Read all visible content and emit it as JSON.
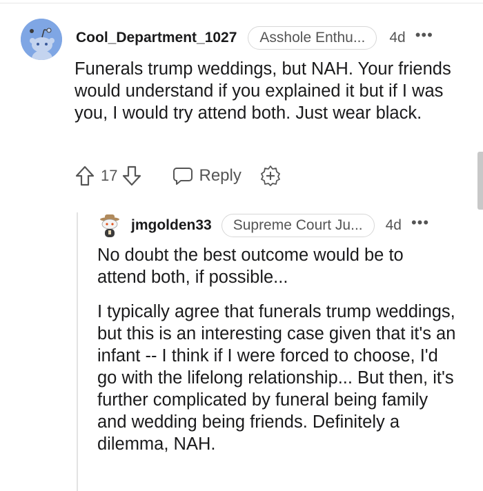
{
  "comment": {
    "username": "Cool_Department_1027",
    "flair": "Asshole Enthu...",
    "age": "4d",
    "more": "•••",
    "body": "Funerals trump weddings, but NAH. Your friends would understand if you explained it but if I was you, I would try attend both. Just wear black.",
    "votes": "17",
    "reply_label": "Reply"
  },
  "reply": {
    "username": "jmgolden33",
    "flair": "Supreme Court Ju...",
    "age": "4d",
    "more": "•••",
    "paragraphs": [
      "No doubt the best outcome would be to attend both, if possible...",
      "I typically agree that funerals trump weddings, but this is an interesting case given that it's an infant -- I think if I were forced to choose, I'd go with the lifelong relationship... But then, it's further complicated by funeral being family and wedding being friends. Definitely a dilemma, NAH."
    ]
  },
  "icons": {
    "upvote": "upvote-arrow-icon",
    "downvote": "downvote-arrow-icon",
    "reply": "speech-bubble-icon",
    "award": "award-plus-icon",
    "more": "more-dots-icon"
  },
  "colors": {
    "avatar_bg": "#7fa6e4",
    "text": "#1a1a1b",
    "muted": "#555555"
  }
}
